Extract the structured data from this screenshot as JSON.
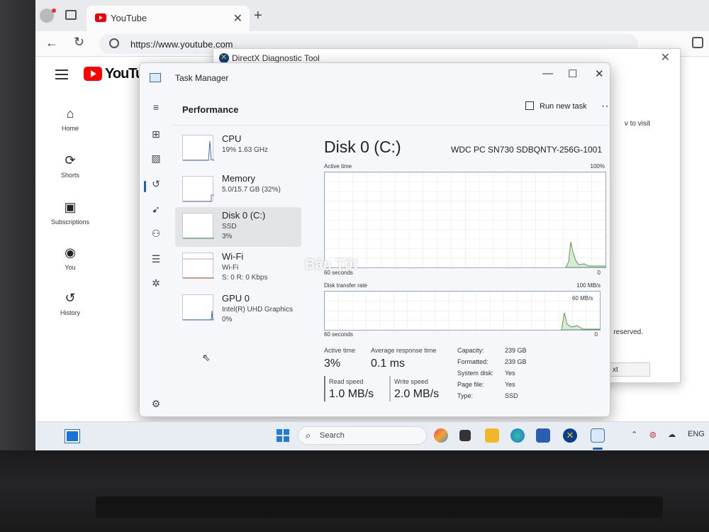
{
  "browser": {
    "tab_title": "YouTube",
    "new_tab": "+",
    "tab_close": "✕",
    "url": "https://www.youtube.com"
  },
  "youtube": {
    "brand": "YouTub",
    "nav": [
      {
        "label": "Home",
        "icon": "home-icon"
      },
      {
        "label": "Shorts",
        "icon": "shorts-icon"
      },
      {
        "label": "Subscriptions",
        "icon": "subscriptions-icon"
      },
      {
        "label": "You",
        "icon": "you-icon"
      },
      {
        "label": "History",
        "icon": "history-icon"
      }
    ]
  },
  "directx": {
    "title": "DirectX Diagnostic Tool",
    "text_visit": "v to visit",
    "text_reserved": "reserved.",
    "button_fragment": "xt"
  },
  "taskmanager": {
    "title": "Task Manager",
    "page_title": "Performance",
    "run_new_task": "Run new task",
    "more": "···",
    "items": [
      {
        "name": "CPU",
        "sub1": "19%  1.63 GHz",
        "sub2": "",
        "sub3": ""
      },
      {
        "name": "Memory",
        "sub1": "5.0/15.7 GB (32%)",
        "sub2": "",
        "sub3": ""
      },
      {
        "name": "Disk 0 (C:)",
        "sub1": "SSD",
        "sub2": "3%",
        "sub3": ""
      },
      {
        "name": "Wi-Fi",
        "sub1": "Wi-Fi",
        "sub2": "S: 0  R: 0 Kbps",
        "sub3": ""
      },
      {
        "name": "GPU 0",
        "sub1": "Intel(R) UHD Graphics",
        "sub2": "0%",
        "sub3": ""
      }
    ],
    "disk": {
      "title": "Disk 0 (C:)",
      "model": "WDC PC SN730 SDBQNTY-256G-1001",
      "active_time_label": "Active time",
      "active_time_max": "100%",
      "active_time_min": "0",
      "active_time_span": "60 seconds",
      "transfer_label": "Disk transfer rate",
      "transfer_max": "100 MB/s",
      "transfer_mid": "60 MB/s",
      "transfer_min": "0",
      "transfer_span": "60 seconds",
      "stats": {
        "active_time_label": "Active time",
        "active_time_value": "3%",
        "avg_resp_label": "Average response time",
        "avg_resp_value": "0.1 ms",
        "read_label": "Read speed",
        "read_value": "1.0 MB/s",
        "write_label": "Write speed",
        "write_value": "2.0 MB/s",
        "capacity_label": "Capacity:",
        "capacity_value": "239 GB",
        "formatted_label": "Formatted:",
        "formatted_value": "239 GB",
        "system_disk_label": "System disk:",
        "system_disk_value": "Yes",
        "page_file_label": "Page file:",
        "page_file_value": "Yes",
        "type_label": "Type:",
        "type_value": "SSD"
      }
    }
  },
  "watermark": "Bán Tốt",
  "taskbar": {
    "search_placeholder": "Search",
    "language": "ENG"
  },
  "colors": {
    "accent": "#1d5fb4",
    "youtube_red": "#ff0000",
    "chart_line": "#9ab"
  }
}
